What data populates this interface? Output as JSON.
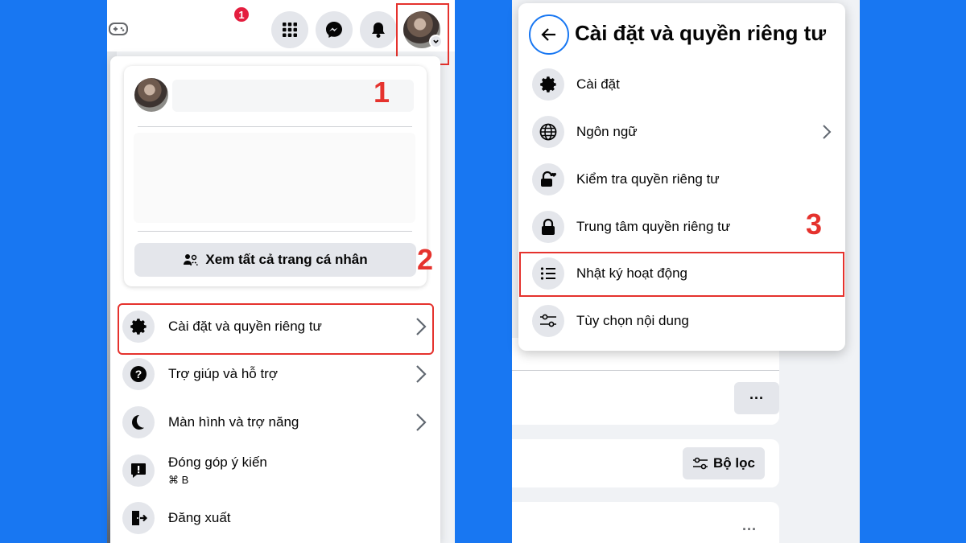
{
  "left": {
    "topbar": {
      "icons": [
        "gamepad-icon",
        "menu-grid-icon",
        "messenger-icon",
        "bell-icon",
        "profile-avatar"
      ],
      "messenger_badge": "1"
    },
    "see_all_label": "Xem tất cả trang cá nhân",
    "menu_items": [
      {
        "label": "Cài đặt và quyền riêng tư",
        "icon": "gear-icon",
        "has_arrow": true
      },
      {
        "label": "Trợ giúp và hỗ trợ",
        "icon": "question-icon",
        "has_arrow": true
      },
      {
        "label": "Màn hình và trợ năng",
        "icon": "moon-icon",
        "has_arrow": true
      },
      {
        "label": "Đóng góp ý kiến",
        "sub": "⌘ B",
        "icon": "feedback-icon",
        "has_arrow": false
      },
      {
        "label": "Đăng xuất",
        "icon": "logout-icon",
        "has_arrow": false
      }
    ]
  },
  "right": {
    "popup_title": "Cài đặt và quyền riêng tư",
    "items": [
      {
        "label": "Cài đặt",
        "icon": "gear-icon"
      },
      {
        "label": "Ngôn ngữ",
        "icon": "globe-icon",
        "has_arrow": true
      },
      {
        "label": "Kiểm tra quyền riêng tư",
        "icon": "lock-heart-icon"
      },
      {
        "label": "Trung tâm quyền riêng tư",
        "icon": "lock-icon"
      },
      {
        "label": "Nhật ký hoạt động",
        "icon": "list-icon"
      },
      {
        "label": "Tùy chọn nội dung",
        "icon": "sliders-icon"
      }
    ],
    "filter_label": "Bộ lọc",
    "more_label": "···"
  },
  "steps": [
    "1",
    "2",
    "3"
  ],
  "colors": {
    "background": "#1877f2",
    "highlight": "#e5322d",
    "badge": "#e41e3f"
  }
}
